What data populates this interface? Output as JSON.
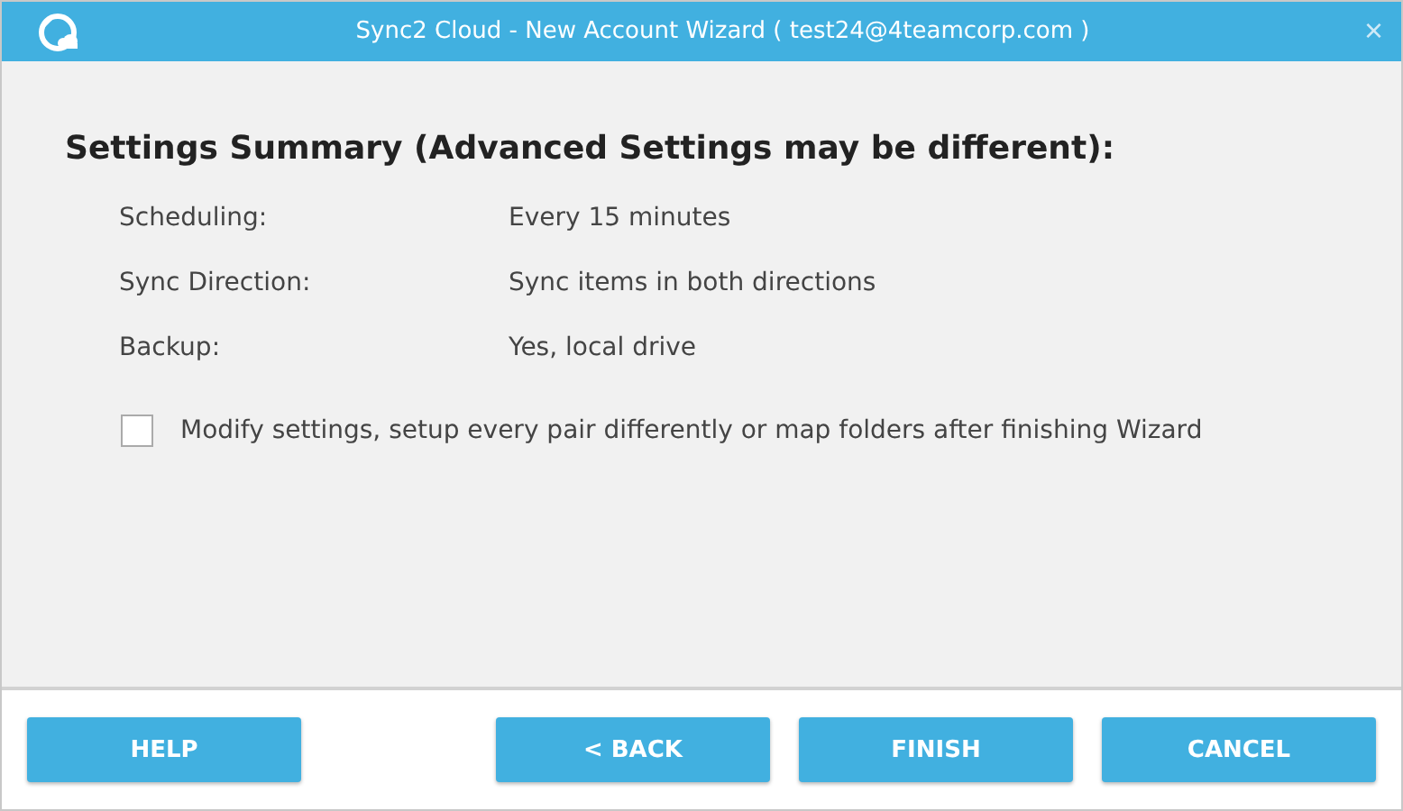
{
  "window": {
    "title": "Sync2 Cloud - New Account Wizard  ( test24@4teamcorp.com )",
    "close": "×"
  },
  "heading": "Settings Summary (Advanced Settings may be different):",
  "summary": [
    {
      "label": "Scheduling:",
      "value": "Every 15 minutes"
    },
    {
      "label": "Sync Direction:",
      "value": "Sync items in both directions"
    },
    {
      "label": "Backup:",
      "value": "Yes, local drive"
    }
  ],
  "option": {
    "label": "Modify settings, setup every pair differently or map folders after finishing Wizard",
    "checked": false
  },
  "help_button": "HELP",
  "buttons": [
    "< BACK",
    "FINISH",
    "CANCEL"
  ]
}
